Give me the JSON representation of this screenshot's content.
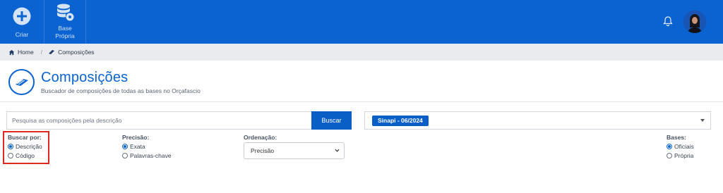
{
  "topbar": {
    "create_label": "Criar",
    "base_label_line1": "Base",
    "base_label_line2": "Própria",
    "brand_color": "#0a63d1"
  },
  "breadcrumb": {
    "home": "Home",
    "separator": "/",
    "current": "Composições"
  },
  "header": {
    "title": "Composições",
    "subtitle": "Buscador de composições de todas as bases no Orçafascio"
  },
  "search": {
    "placeholder": "Pesquisa as composições pela descrição",
    "button_label": "Buscar",
    "base_selected": "Sinapi - 06/2024"
  },
  "filters": {
    "search_by": {
      "label": "Buscar por:",
      "options": [
        "Descrição",
        "Código"
      ],
      "selected": "Descrição"
    },
    "precision": {
      "label": "Precisão:",
      "options": [
        "Exata",
        "Palavras-chave"
      ],
      "selected": "Exata"
    },
    "ordering": {
      "label": "Ordenação:",
      "selected": "Precisão"
    },
    "bases": {
      "label": "Bases:",
      "options": [
        "Oficiais",
        "Própria"
      ],
      "selected": "Oficiais"
    }
  },
  "icons": {
    "create": "plus-circle-icon",
    "base": "database-gear-icon",
    "notifications": "bell-icon",
    "home": "home-icon",
    "compositions": "trowel-icon"
  }
}
